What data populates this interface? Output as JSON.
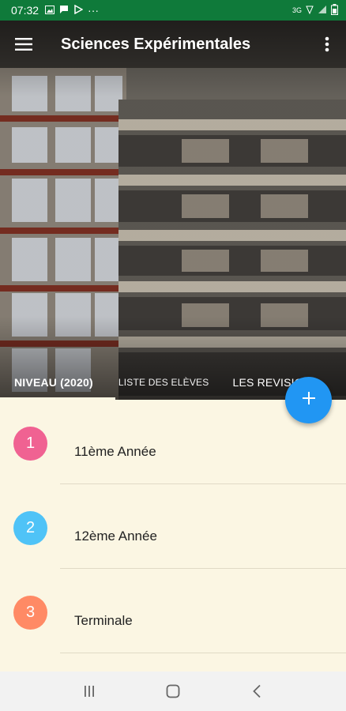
{
  "status_bar": {
    "time": "07:32",
    "dots": "···",
    "net_type": "3G",
    "icons": [
      "image-icon",
      "message-icon",
      "play-icon",
      "wifi-off-icon",
      "signal-icon",
      "battery-icon"
    ]
  },
  "app_bar": {
    "title": "Sciences Expérimentales",
    "menu_icon": "hamburger-icon",
    "overflow_icon": "more-vert-icon"
  },
  "tabs": [
    {
      "label": "NIVEAU (2020)",
      "active": true
    },
    {
      "label": "LISTE DES ELÈVES",
      "active": false
    },
    {
      "label": "LES REVISIONS",
      "active": false
    }
  ],
  "levels": [
    {
      "number": "1",
      "label": "11ème Année",
      "color": "#f06292"
    },
    {
      "number": "2",
      "label": "12ème Année",
      "color": "#4fc3f7"
    },
    {
      "number": "3",
      "label": "Terminale",
      "color": "#ff8a65"
    }
  ],
  "fab": {
    "icon": "plus-icon",
    "color": "#2196f3"
  },
  "colors": {
    "status_bar": "#0f7a3a",
    "list_background": "#fbf6e3",
    "tab_indicator": "#fbf6e3"
  },
  "nav_bar": {
    "icons": [
      "recent-apps-icon",
      "home-icon",
      "back-icon"
    ]
  }
}
